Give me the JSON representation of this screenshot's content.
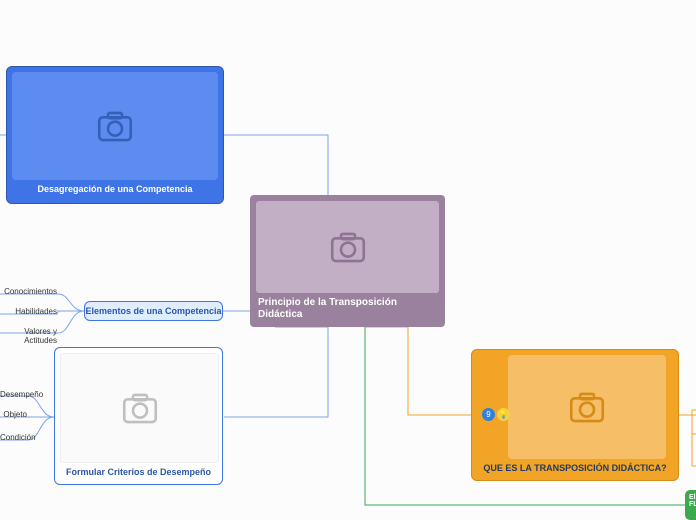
{
  "central": {
    "title": "Principio de la Transposición Didáctica"
  },
  "blue": {
    "title": "Desagregación de una Competencia"
  },
  "lightblue": {
    "title": "Elementos de una Competencia",
    "leaves": [
      "Conocimientos",
      "Habilidades",
      "Valores y Actitudes"
    ]
  },
  "white": {
    "title": "Formular Criterios de Desempeño",
    "leaves": [
      "Desempeño",
      "Objeto",
      "Condición"
    ]
  },
  "orange": {
    "title": "QUE ES LA TRANSPOSICIÓN DIDÁCTICA?",
    "badge_text": "9"
  },
  "green": {
    "line1": "El",
    "line2": "FL"
  }
}
